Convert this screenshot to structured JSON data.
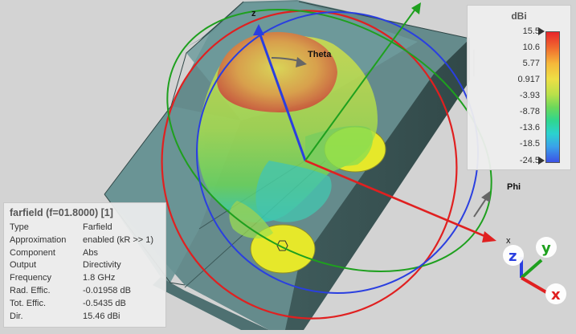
{
  "viewport": {
    "theta_label": "Theta",
    "phi_label": "Phi",
    "z_label": "z",
    "x_label": "x"
  },
  "legend": {
    "unit": "dBi",
    "ticks": [
      "15.5",
      "10.6",
      "5.77",
      "0.917",
      "-3.93",
      "-8.78",
      "-13.6",
      "-18.5",
      "-24.5"
    ],
    "colors": {
      "max": "#e8262b",
      "mid": "#eedf45",
      "green": "#6bd85a",
      "cyan": "#2bd2cf",
      "min": "#3c52e6"
    }
  },
  "info": {
    "title": "farfield (f=01.8000) [1]",
    "rows": [
      {
        "key": "Type",
        "value": "Farfield"
      },
      {
        "key": "Approximation",
        "value": "enabled (kR >> 1)"
      },
      {
        "key": "Component",
        "value": "Abs"
      },
      {
        "key": "Output",
        "value": "Directivity"
      },
      {
        "key": "Frequency",
        "value": "1.8 GHz"
      },
      {
        "key": "Rad. Effic.",
        "value": "-0.01958 dB"
      },
      {
        "key": "Tot. Effic.",
        "value": "-0.5435 dB"
      },
      {
        "key": "Dir.",
        "value": "15.46 dBi"
      }
    ]
  },
  "triad": {
    "x_label": "x",
    "y_label": "y",
    "z_label": "z",
    "x_color": "#e02020",
    "y_color": "#1ea01e",
    "z_color": "#2a3fe0"
  }
}
